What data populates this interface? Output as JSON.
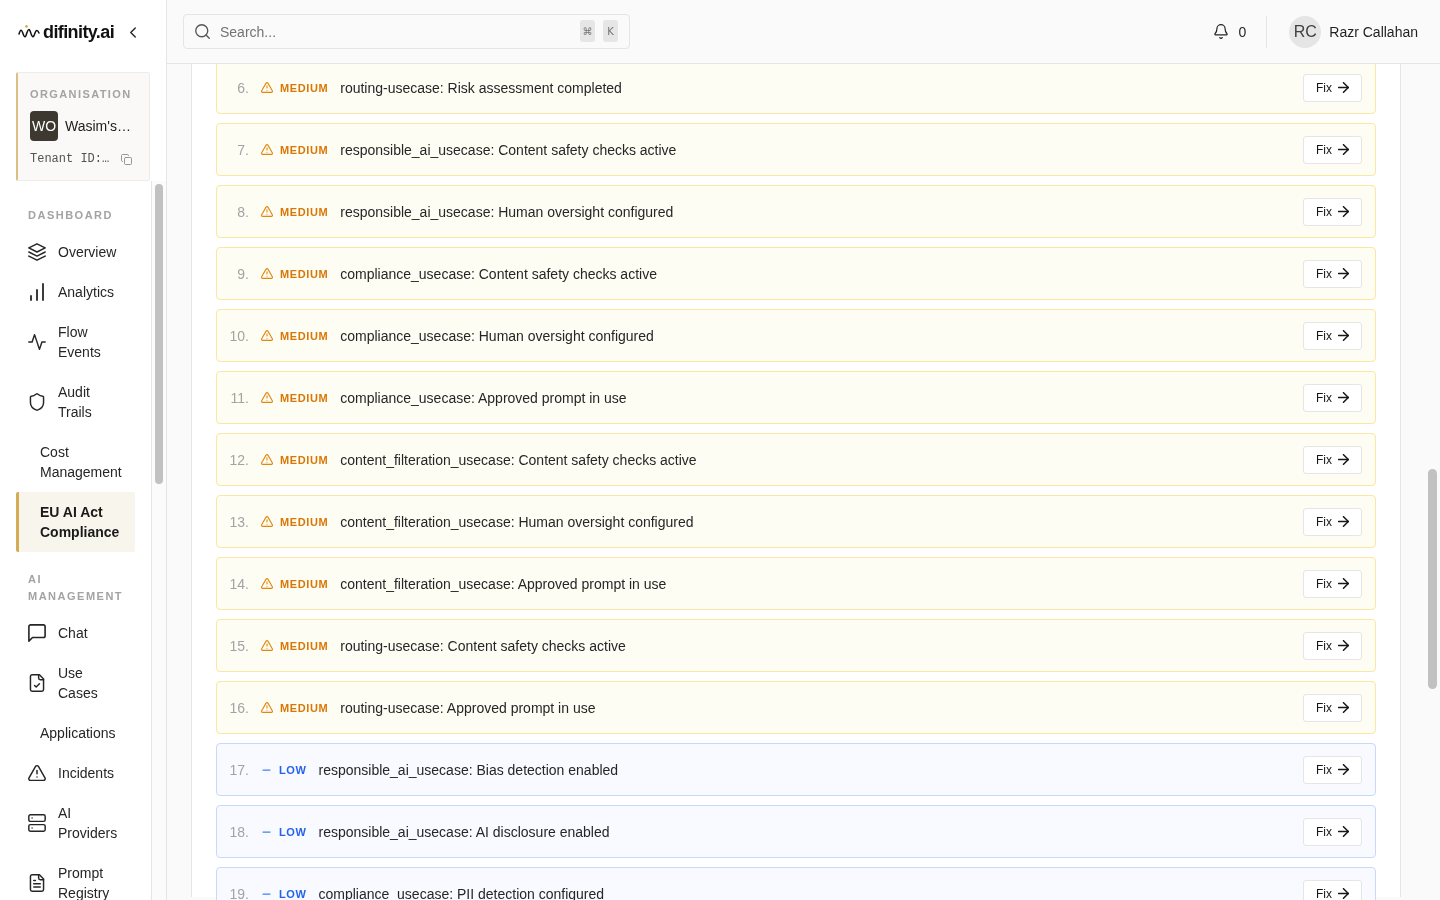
{
  "sidebar": {
    "logo": "difinity.ai",
    "organisation": {
      "label": "ORGANISATION",
      "initials": "WO",
      "name": "Wasim's…",
      "tenant": "Tenant ID:…"
    },
    "sections": [
      {
        "title": "DASHBOARD",
        "items": [
          {
            "label": "Overview",
            "selected": false
          },
          {
            "label": "Analytics",
            "selected": false
          },
          {
            "label": "Flow Events",
            "selected": false
          },
          {
            "label": "Audit Trails",
            "selected": false
          },
          {
            "label": "Cost Management",
            "selected": false
          },
          {
            "label": "EU AI Act Compliance",
            "selected": true
          }
        ]
      },
      {
        "title": "AI MANAGEMENT",
        "items": [
          {
            "label": "Chat",
            "selected": false
          },
          {
            "label": "Use Cases",
            "selected": false
          },
          {
            "label": "Applications",
            "selected": false
          },
          {
            "label": "Incidents",
            "selected": false
          },
          {
            "label": "AI Providers",
            "selected": false
          },
          {
            "label": "Prompt Registry",
            "selected": false
          }
        ]
      }
    ]
  },
  "header": {
    "search": {
      "placeholder": "Search...",
      "keys": [
        "⌘",
        "K"
      ]
    },
    "notifications": {
      "count": "0"
    },
    "user": {
      "initials": "RC",
      "name": "Razr Callahan"
    }
  },
  "checks": [
    {
      "number": "6.",
      "kind": "medium",
      "severity": "MEDIUM",
      "title": "routing-usecase: Risk assessment completed",
      "action": "Fix"
    },
    {
      "number": "7.",
      "kind": "medium",
      "severity": "MEDIUM",
      "title": "responsible_ai_usecase: Content safety checks active",
      "action": "Fix"
    },
    {
      "number": "8.",
      "kind": "medium",
      "severity": "MEDIUM",
      "title": "responsible_ai_usecase: Human oversight configured",
      "action": "Fix"
    },
    {
      "number": "9.",
      "kind": "medium",
      "severity": "MEDIUM",
      "title": "compliance_usecase: Content safety checks active",
      "action": "Fix"
    },
    {
      "number": "10.",
      "kind": "medium",
      "severity": "MEDIUM",
      "title": "compliance_usecase: Human oversight configured",
      "action": "Fix"
    },
    {
      "number": "11.",
      "kind": "medium",
      "severity": "MEDIUM",
      "title": "compliance_usecase: Approved prompt in use",
      "action": "Fix"
    },
    {
      "number": "12.",
      "kind": "medium",
      "severity": "MEDIUM",
      "title": "content_filteration_usecase: Content safety checks active",
      "action": "Fix"
    },
    {
      "number": "13.",
      "kind": "medium",
      "severity": "MEDIUM",
      "title": "content_filteration_usecase: Human oversight configured",
      "action": "Fix"
    },
    {
      "number": "14.",
      "kind": "medium",
      "severity": "MEDIUM",
      "title": "content_filteration_usecase: Approved prompt in use",
      "action": "Fix"
    },
    {
      "number": "15.",
      "kind": "medium",
      "severity": "MEDIUM",
      "title": "routing-usecase: Content safety checks active",
      "action": "Fix"
    },
    {
      "number": "16.",
      "kind": "medium",
      "severity": "MEDIUM",
      "title": "routing-usecase: Approved prompt in use",
      "action": "Fix"
    },
    {
      "number": "17.",
      "kind": "low",
      "severity": "LOW",
      "title": "responsible_ai_usecase: Bias detection enabled",
      "action": "Fix"
    },
    {
      "number": "18.",
      "kind": "low",
      "severity": "LOW",
      "title": "responsible_ai_usecase: AI disclosure enabled",
      "action": "Fix"
    },
    {
      "number": "19.",
      "kind": "low",
      "severity": "LOW",
      "title": "compliance_usecase: PII detection configured",
      "action": "Fix"
    }
  ]
}
